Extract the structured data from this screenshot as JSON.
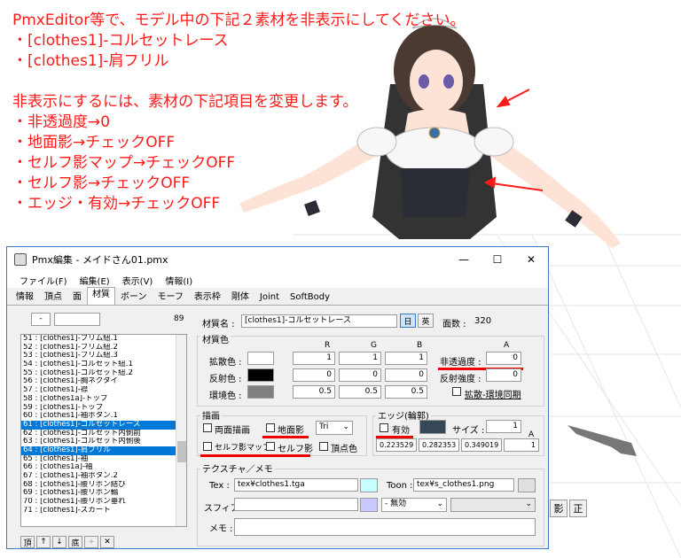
{
  "note": {
    "lines": [
      "PmxEditor等で、モデル中の下記２素材を非表示にしてください。",
      "・[clothes1]-コルセットレース",
      "・[clothes1]-肩フリル",
      "",
      "非表示にするには、素材の下記項目を変更します。",
      "・非透過度→0",
      "・地面影→チェックOFF",
      "・セルフ影マップ→チェックOFF",
      "・セルフ影→チェックOFF",
      "・エッジ・有効→チェックOFF"
    ],
    "color": "#ff1a1a"
  },
  "background": {
    "btn_1": "影",
    "btn_2": "正"
  },
  "window": {
    "title": "Pmx編集 - メイドさん01.pmx",
    "controls": [
      "—",
      "☐",
      "✕"
    ],
    "menu": [
      "ファイル(F)",
      "編集(E)",
      "表示(V)",
      "情報(I)"
    ],
    "tabs": [
      "情報",
      "頂点",
      "面",
      "材質",
      "ボーン",
      "モーフ",
      "表示枠",
      "剛体",
      "Joint",
      "SoftBody"
    ],
    "active_tab": "材質"
  },
  "list": {
    "filter_value": "-",
    "count": "89",
    "items": [
      "51 : [clothes1]-フリム紐.1",
      "52 : [clothes1]-フリム紐.2",
      "53 : [clothes1]-フリム紐.3",
      "54 : [clothes1]-コルセット紐.1",
      "55 : [clothes1]-コルセット紐.2",
      "56 : [clothes1]-胸ネクタイ",
      "57 : [clothes1]-襟",
      "58 : [clothes1a]-トップ",
      "59 : [clothes1]-トップ",
      "60 : [clothes1]-袖ボタン.1",
      "61 : [clothes1]-コルセットレース",
      "62 : [clothes1]-コルセット内側前",
      "63 : [clothes1]-コルセット内側後",
      "64 : [clothes1]-肩フリル",
      "65 : [clothes1]-袖",
      "66 : [clothes1a]-袖",
      "67 : [clothes1]-袖ボタン.2",
      "68 : [clothes1]-腰リボン結び",
      "69 : [clothes1]-腰リボン輪",
      "70 : [clothes1]-腰リボン垂れ",
      "71 : [clothes1]-スカート"
    ],
    "selected": [
      10,
      13
    ],
    "buttons": [
      "頂",
      "↑",
      "↓",
      "底",
      "+",
      "✕"
    ]
  },
  "material": {
    "name_label": "材質名 :",
    "name_value": "[clothes1]-コルセットレース",
    "btn_j": "日",
    "btn_e": "英",
    "face_count_label": "面数 :",
    "face_count": "320",
    "color_group": "材質色",
    "col_r": "R",
    "col_g": "G",
    "col_b": "B",
    "col_a": "A",
    "diffuse_label": "拡散色 :",
    "diffuse": [
      "1",
      "1",
      "1"
    ],
    "specular_label": "反射色 :",
    "specular": [
      "0",
      "0",
      "0"
    ],
    "ambient_label": "環境色 :",
    "ambient": [
      "0.5",
      "0.5",
      "0.5"
    ],
    "opacity_label": "非透過度 :",
    "opacity": "0",
    "spec_power_label": "反射強度 :",
    "spec_power": "0",
    "sync_label": "拡散-環境同期",
    "draw_group": "描画",
    "double_sided": "両面描画",
    "ground_shadow": "地面影",
    "primitive": "Tri",
    "self_shadow_map": "セルフ影マップ",
    "self_shadow": "セルフ影",
    "vertex_color": "頂点色",
    "edge_group": "エッジ(輪郭)",
    "edge_enabled": "有効",
    "edge_size_label": "サイズ :",
    "edge_size": "1",
    "edge_color": [
      "0.223529",
      "0.282353",
      "0.349019",
      "1"
    ],
    "edge_a_label": "A",
    "tex_group": "テクスチャ／メモ",
    "tex_label": "Tex :",
    "tex_value": "tex¥clothes1.tga",
    "toon_label": "Toon :",
    "toon_value": "tex¥s_clothes1.png",
    "sphere_label": "スフィア :",
    "sphere_mode": "- 無効",
    "memo_label": "メモ :"
  },
  "colors": {
    "swatch_diffuse": "#ffffff",
    "swatch_specular": "#000000",
    "swatch_ambient": "#808080",
    "swatch_edge": "#394859",
    "swatch_tex": "#c8ffff",
    "swatch_sphere": "#c8c8ff",
    "selection": "#0078d7",
    "highlight": "#e00000"
  }
}
